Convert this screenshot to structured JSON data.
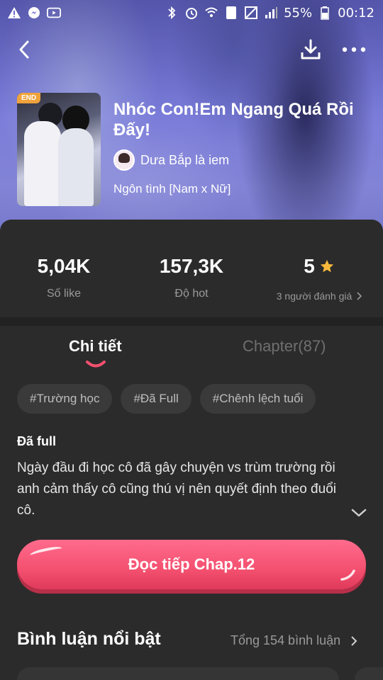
{
  "status_bar": {
    "battery": "55%",
    "time": "00:12",
    "sim": "1"
  },
  "book": {
    "badge": "END",
    "title": "Nhóc Con!Em Ngang Quá Rồi Đấy!",
    "author": "Dưa Bắp là iem",
    "genre": "Ngôn tình [Nam x Nữ]"
  },
  "stats": {
    "likes_value": "5,04K",
    "likes_label": "Số like",
    "hot_value": "157,3K",
    "hot_label": "Độ hot",
    "rating_value": "5",
    "rating_label": "3 người đánh giá"
  },
  "tabs": {
    "details": "Chi tiết",
    "chapters": "Chapter(87)"
  },
  "tags": [
    "#Trường học",
    "#Đã Full",
    "#Chênh lệch tuổi"
  ],
  "description": {
    "title": "Đã full",
    "body": "Ngày đầu đi học cô đã gây chuyện vs trùm trường rồi anh cảm thấy cô cũng thú vị nên quyết định theo đuổi cô."
  },
  "read_button": "Đọc tiếp Chap.12",
  "comments": {
    "title": "Bình luận nổi bật",
    "total": "Tổng 154 bình luận"
  },
  "colors": {
    "accent": "#f4506f",
    "star": "#f6b93b",
    "card_bg": "#2b2b2b"
  },
  "icons": {
    "back": "chevron-left-icon",
    "download": "download-icon",
    "more": "more-horizontal-icon"
  }
}
